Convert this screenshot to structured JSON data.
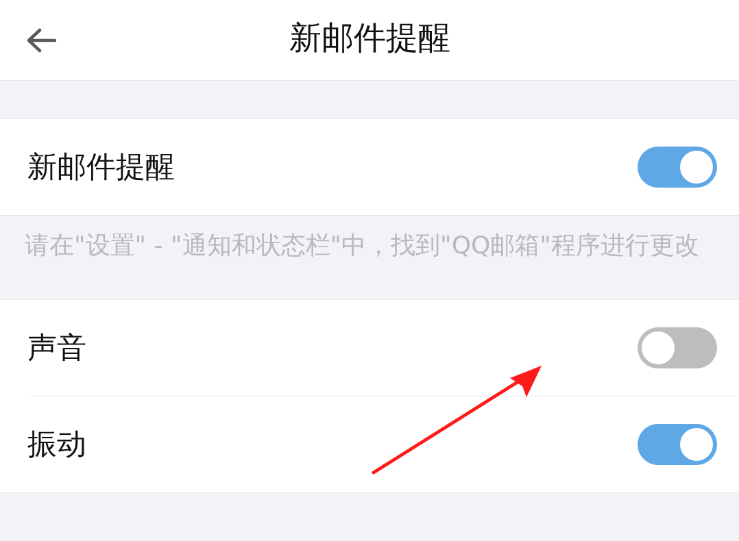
{
  "header": {
    "title": "新邮件提醒"
  },
  "sections": [
    {
      "rows": [
        {
          "label": "新邮件提醒",
          "on": true
        }
      ],
      "note": "请在\"设置\" - \"通知和状态栏\"中，找到\"QQ邮箱\"程序进行更改"
    },
    {
      "rows": [
        {
          "label": "声音",
          "on": false
        },
        {
          "label": "振动",
          "on": true
        }
      ]
    }
  ]
}
